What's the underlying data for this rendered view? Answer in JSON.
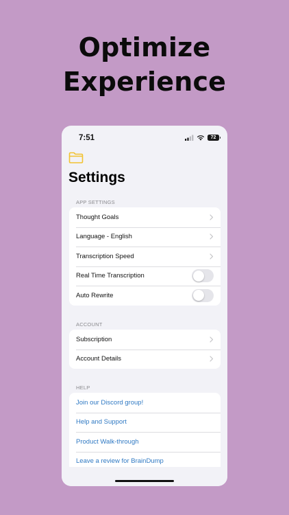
{
  "headline": {
    "line1": "Optimize",
    "line2": "Experience"
  },
  "status_bar": {
    "time": "7:51",
    "battery": "72"
  },
  "page_title": "Settings",
  "app_settings": {
    "label": "APP SETTINGS",
    "items": [
      {
        "label": "Thought Goals"
      },
      {
        "label": "Language - English"
      },
      {
        "label": "Transcription Speed"
      },
      {
        "label": "Real Time Transcription",
        "toggle_on": false
      },
      {
        "label": "Auto Rewrite",
        "toggle_on": false
      }
    ]
  },
  "account": {
    "label": "ACCOUNT",
    "items": [
      {
        "label": "Subscription"
      },
      {
        "label": "Account Details"
      }
    ]
  },
  "help": {
    "label": "HELP",
    "items": [
      {
        "label": "Join our Discord group!"
      },
      {
        "label": "Help and Support"
      },
      {
        "label": "Product Walk-through"
      },
      {
        "label": "Leave a review for BrainDump"
      }
    ]
  },
  "colors": {
    "background": "#c39ac6",
    "link": "#2f79c3",
    "folder_icon": "#f2c230"
  }
}
